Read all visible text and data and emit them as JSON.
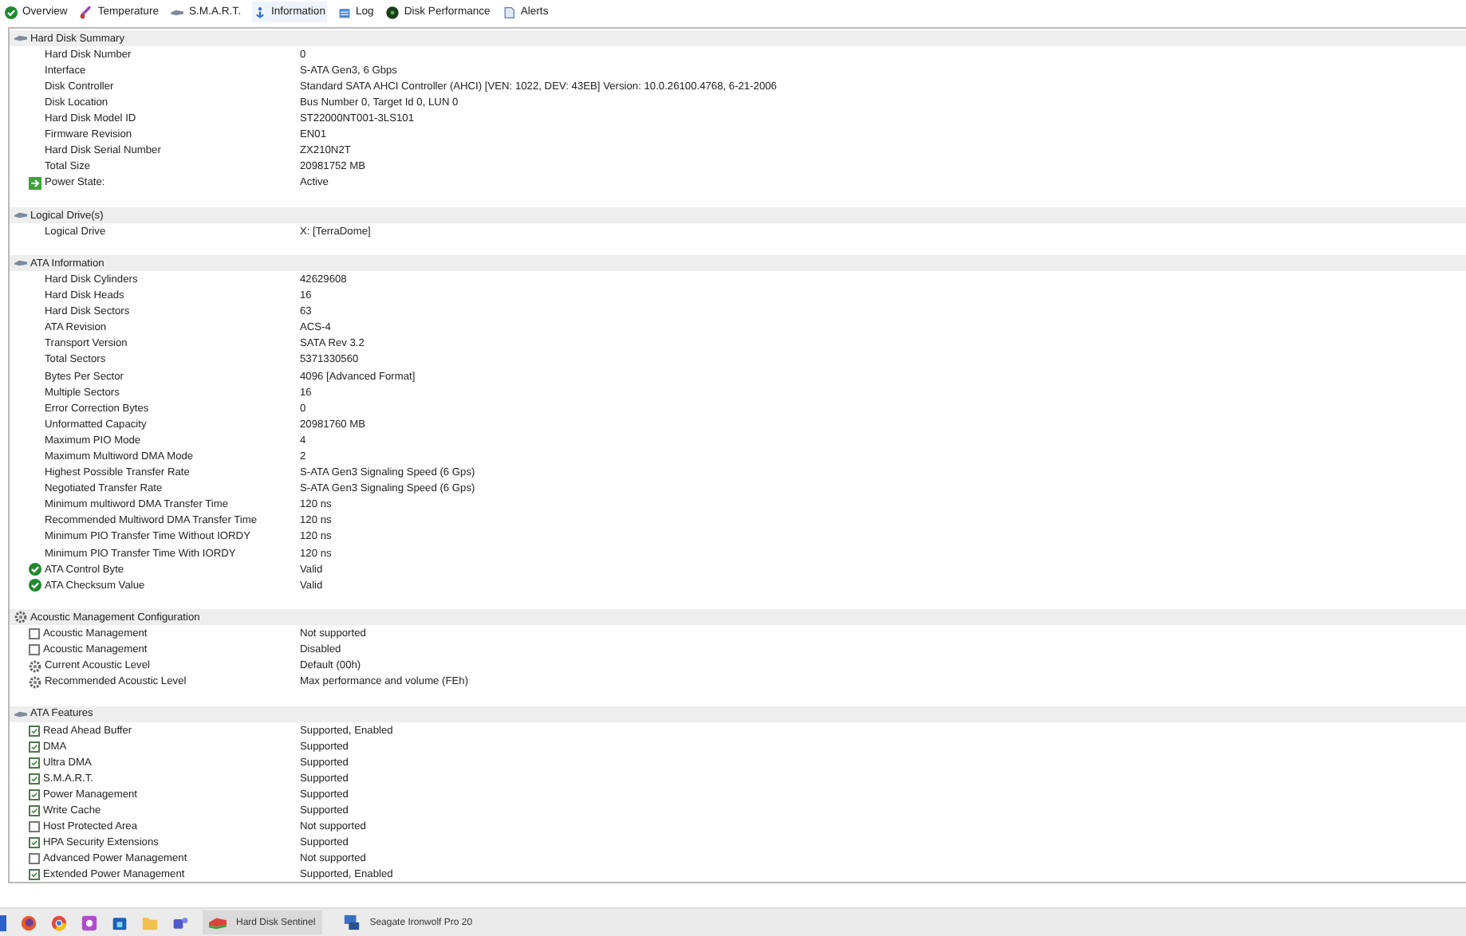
{
  "toolbar": {
    "tabs": [
      {
        "label": "Overview",
        "selected": false
      },
      {
        "label": "Temperature",
        "selected": false
      },
      {
        "label": "S.M.A.R.T.",
        "selected": false
      },
      {
        "label": "Information",
        "selected": true
      },
      {
        "label": "Log",
        "selected": false
      },
      {
        "label": "Disk Performance",
        "selected": false
      },
      {
        "label": "Alerts",
        "selected": false
      }
    ]
  },
  "sections": [
    {
      "title": "Hard Disk Summary",
      "kind": "drive",
      "rows": [
        {
          "kind": "plain",
          "label": "Hard Disk Number",
          "value": "0"
        },
        {
          "kind": "plain",
          "label": "Interface",
          "value": "S-ATA Gen3, 6 Gbps"
        },
        {
          "kind": "plain",
          "label": "Disk Controller",
          "value": "Standard SATA AHCI Controller (AHCI) [VEN: 1022, DEV: 43EB] Version: 10.0.26100.4768, 6-21-2006"
        },
        {
          "kind": "plain",
          "label": "Disk Location",
          "value": "Bus Number 0, Target Id 0, LUN 0"
        },
        {
          "kind": "plain",
          "label": "Hard Disk Model ID",
          "value": "ST22000NT001-3LS101"
        },
        {
          "kind": "plain",
          "label": "Firmware Revision",
          "value": "EN01"
        },
        {
          "kind": "plain",
          "label": "Hard Disk Serial Number",
          "value": "ZX210N2T"
        },
        {
          "kind": "plain",
          "label": "Total Size",
          "value": "20981752 MB"
        },
        {
          "kind": "power",
          "label": "Power State:",
          "value": "Active"
        }
      ]
    },
    {
      "title": "Logical Drive(s)",
      "kind": "drive",
      "rows": [
        {
          "kind": "plain",
          "label": "Logical Drive",
          "value": "X: [TerraDome]"
        }
      ]
    },
    {
      "title": "ATA Information",
      "kind": "drive",
      "rows": [
        {
          "kind": "plain",
          "label": "Hard Disk Cylinders",
          "value": "42629608"
        },
        {
          "kind": "plain",
          "label": "Hard Disk Heads",
          "value": "16"
        },
        {
          "kind": "plain",
          "label": "Hard Disk Sectors",
          "value": "63"
        },
        {
          "kind": "plain",
          "label": "ATA Revision",
          "value": "ACS-4"
        },
        {
          "kind": "plain",
          "label": "Transport Version",
          "value": "SATA Rev 3.2"
        },
        {
          "kind": "plain",
          "label": "Total Sectors",
          "value": "5371330560"
        },
        {
          "kind": "plain",
          "label": "Bytes Per Sector",
          "value": "4096 [Advanced Format]"
        },
        {
          "kind": "plain",
          "label": "Multiple Sectors",
          "value": "16"
        },
        {
          "kind": "plain",
          "label": "Error Correction Bytes",
          "value": "0"
        },
        {
          "kind": "plain",
          "label": "Unformatted Capacity",
          "value": "20981760 MB"
        },
        {
          "kind": "plain",
          "label": "Maximum PIO Mode",
          "value": "4"
        },
        {
          "kind": "plain",
          "label": "Maximum Multiword DMA Mode",
          "value": "2"
        },
        {
          "kind": "plain",
          "label": "Highest Possible Transfer Rate",
          "value": "S-ATA Gen3 Signaling Speed (6 Gps)"
        },
        {
          "kind": "plain",
          "label": "Negotiated Transfer Rate",
          "value": "S-ATA Gen3 Signaling Speed (6 Gps)"
        },
        {
          "kind": "plain",
          "label": "Minimum multiword DMA Transfer Time",
          "value": "120 ns"
        },
        {
          "kind": "plain",
          "label": "Recommended Multiword DMA Transfer Time",
          "value": "120 ns"
        },
        {
          "kind": "plain",
          "label": "Minimum PIO Transfer Time Without IORDY",
          "value": "120 ns"
        },
        {
          "kind": "plain",
          "label": "Minimum PIO Transfer Time With IORDY",
          "value": "120 ns"
        },
        {
          "kind": "ok",
          "label": "ATA Control Byte",
          "value": "Valid"
        },
        {
          "kind": "ok",
          "label": "ATA Checksum Value",
          "value": "Valid"
        }
      ]
    },
    {
      "title": "Acoustic Management Configuration",
      "kind": "gear",
      "rows": [
        {
          "kind": "check",
          "checked": false,
          "label": "Acoustic Management",
          "value": "Not supported"
        },
        {
          "kind": "check",
          "checked": false,
          "label": "Acoustic Management",
          "value": "Disabled"
        },
        {
          "kind": "gear",
          "label": "Current Acoustic Level",
          "value": "Default (00h)"
        },
        {
          "kind": "gear",
          "label": "Recommended Acoustic Level",
          "value": "Max performance and volume (FEh)"
        }
      ]
    },
    {
      "title": "ATA Features",
      "kind": "drive",
      "rows": [
        {
          "kind": "check",
          "checked": true,
          "label": "Read Ahead Buffer",
          "value": "Supported, Enabled"
        },
        {
          "kind": "check",
          "checked": true,
          "label": "DMA",
          "value": "Supported"
        },
        {
          "kind": "check",
          "checked": true,
          "label": "Ultra DMA",
          "value": "Supported"
        },
        {
          "kind": "check",
          "checked": true,
          "label": "S.M.A.R.T.",
          "value": "Supported"
        },
        {
          "kind": "check",
          "checked": true,
          "label": "Power Management",
          "value": "Supported"
        },
        {
          "kind": "check",
          "checked": true,
          "label": "Write Cache",
          "value": "Supported"
        },
        {
          "kind": "check",
          "checked": false,
          "label": "Host Protected Area",
          "value": "Not supported"
        },
        {
          "kind": "check",
          "checked": true,
          "label": "HPA Security Extensions",
          "value": "Supported"
        },
        {
          "kind": "check",
          "checked": false,
          "label": "Advanced Power Management",
          "value": "Not supported"
        },
        {
          "kind": "check",
          "checked": true,
          "label": "Extended Power Management",
          "value": "Supported, Enabled"
        }
      ]
    }
  ],
  "taskbar": {
    "apps": [
      {
        "label": "Hard Disk Sentinel",
        "selected": true
      },
      {
        "label": "Seagate Ironwolf Pro 20",
        "selected": false
      }
    ]
  }
}
